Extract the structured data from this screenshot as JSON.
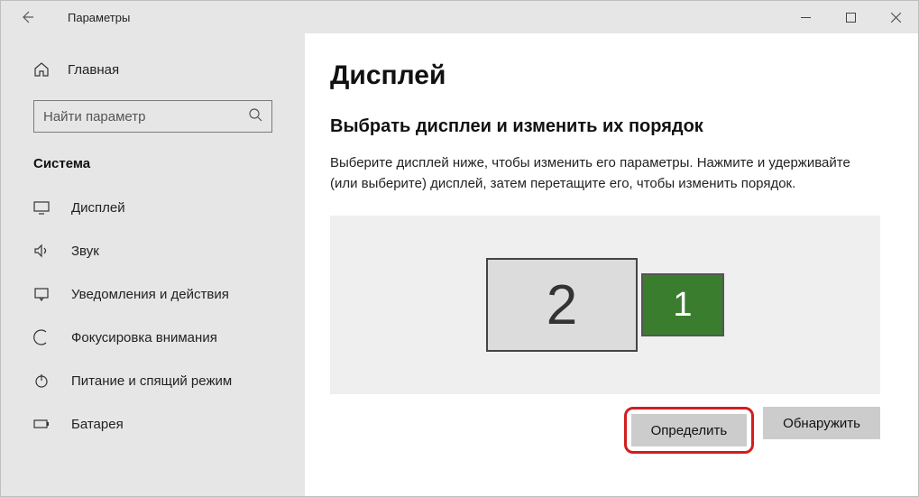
{
  "titlebar": {
    "title": "Параметры"
  },
  "sidebar": {
    "home": "Главная",
    "search_placeholder": "Найти параметр",
    "category": "Система",
    "items": [
      {
        "label": "Дисплей"
      },
      {
        "label": "Звук"
      },
      {
        "label": "Уведомления и действия"
      },
      {
        "label": "Фокусировка внимания"
      },
      {
        "label": "Питание и спящий режим"
      },
      {
        "label": "Батарея"
      }
    ]
  },
  "main": {
    "heading": "Дисплей",
    "subheading": "Выбрать дисплеи и изменить их порядок",
    "description": "Выберите дисплей ниже, чтобы изменить его параметры. Нажмите и удерживайте (или выберите) дисплей, затем перетащите его, чтобы изменить порядок.",
    "monitor2": "2",
    "monitor1": "1",
    "identify": "Определить",
    "detect": "Обнаружить"
  }
}
